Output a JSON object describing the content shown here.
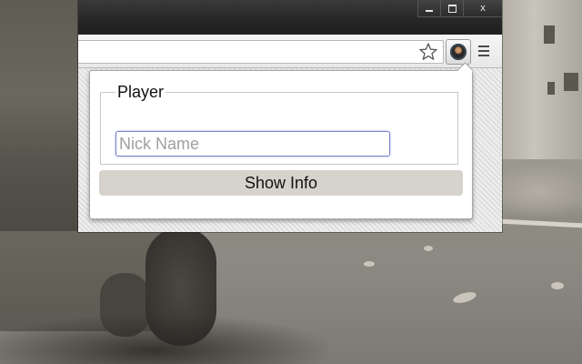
{
  "window": {
    "controls": {
      "minimize_icon": "minimize-icon",
      "maximize_icon": "maximize-icon",
      "close_label": "x"
    }
  },
  "toolbar": {
    "omnibox_value": "",
    "star_icon": "star-icon",
    "extension_icon": "player-avatar-icon",
    "menu_icon": "hamburger-menu-icon"
  },
  "popup": {
    "fieldset_legend": "Player",
    "nick_input": {
      "value": "",
      "placeholder": "Nick Name"
    },
    "show_info_label": "Show Info"
  },
  "colors": {
    "titlebar": "#262626",
    "toolbar": "#ececec",
    "button_bg": "#d6d2cc",
    "input_focus_border": "#7c86c9"
  }
}
